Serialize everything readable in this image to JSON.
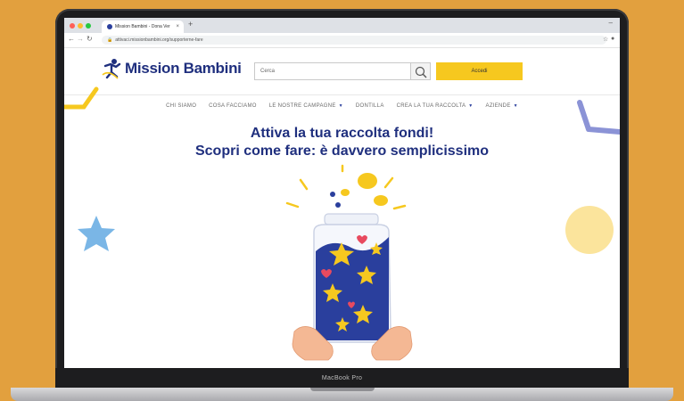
{
  "browser": {
    "tab_title": "Mission Bambini - Dona Ver",
    "tab_close": "×",
    "new_tab": "+",
    "url": "attivaci.missionbambini.org/supporterne-fare",
    "minimize": "–"
  },
  "site": {
    "logo_text": "Mission Bambini",
    "search_placeholder": "Cerca",
    "login_label": "Accedi"
  },
  "menu": {
    "items": [
      {
        "label": "CHI SIAMO",
        "has_dropdown": false
      },
      {
        "label": "COSA FACCIAMO",
        "has_dropdown": false
      },
      {
        "label": "LE NOSTRE CAMPAGNE",
        "has_dropdown": true
      },
      {
        "label": "DONTILLA",
        "has_dropdown": false
      },
      {
        "label": "CREA LA TUA RACCOLTA",
        "has_dropdown": true
      },
      {
        "label": "AZIENDE",
        "has_dropdown": true
      }
    ]
  },
  "hero": {
    "title": "Attiva la tua raccolta fondi!",
    "subtitle": "Scopri come fare: è davvero semplicissimo"
  },
  "device": {
    "label": "MacBook Pro"
  },
  "colors": {
    "background": "#E2A03E",
    "brand_blue": "#1f2f7e",
    "accent_yellow": "#F6C81F",
    "jar_fill": "#2a3f9d",
    "heart_red": "#e84a5f",
    "light_blue_star": "#7ab6e6"
  }
}
